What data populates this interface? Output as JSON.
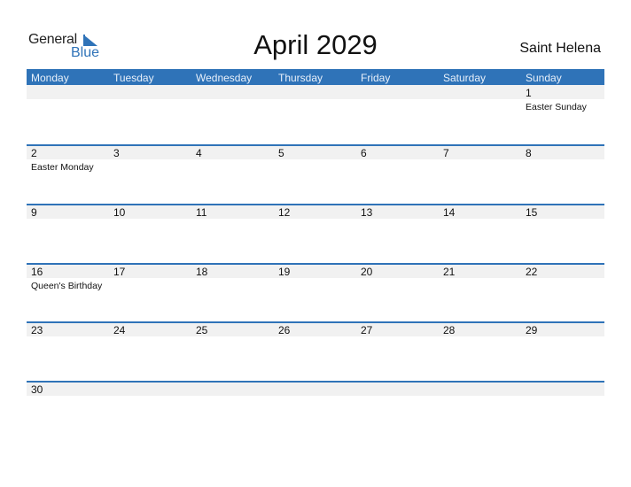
{
  "logo": {
    "general": "General",
    "blue": "Blue"
  },
  "title": "April 2029",
  "country": "Saint Helena",
  "colors": {
    "accent": "#2f73b8",
    "band": "#f1f1f1"
  },
  "weekdays": [
    "Monday",
    "Tuesday",
    "Wednesday",
    "Thursday",
    "Friday",
    "Saturday",
    "Sunday"
  ],
  "weeks": [
    {
      "days": [
        "",
        "",
        "",
        "",
        "",
        "",
        "1"
      ],
      "events": [
        "",
        "",
        "",
        "",
        "",
        "",
        "Easter Sunday"
      ]
    },
    {
      "days": [
        "2",
        "3",
        "4",
        "5",
        "6",
        "7",
        "8"
      ],
      "events": [
        "Easter Monday",
        "",
        "",
        "",
        "",
        "",
        ""
      ]
    },
    {
      "days": [
        "9",
        "10",
        "11",
        "12",
        "13",
        "14",
        "15"
      ],
      "events": [
        "",
        "",
        "",
        "",
        "",
        "",
        ""
      ]
    },
    {
      "days": [
        "16",
        "17",
        "18",
        "19",
        "20",
        "21",
        "22"
      ],
      "events": [
        "Queen's Birthday",
        "",
        "",
        "",
        "",
        "",
        ""
      ]
    },
    {
      "days": [
        "23",
        "24",
        "25",
        "26",
        "27",
        "28",
        "29"
      ],
      "events": [
        "",
        "",
        "",
        "",
        "",
        "",
        ""
      ]
    },
    {
      "days": [
        "30",
        "",
        "",
        "",
        "",
        "",
        ""
      ],
      "events": [
        "",
        "",
        "",
        "",
        "",
        "",
        ""
      ]
    }
  ]
}
